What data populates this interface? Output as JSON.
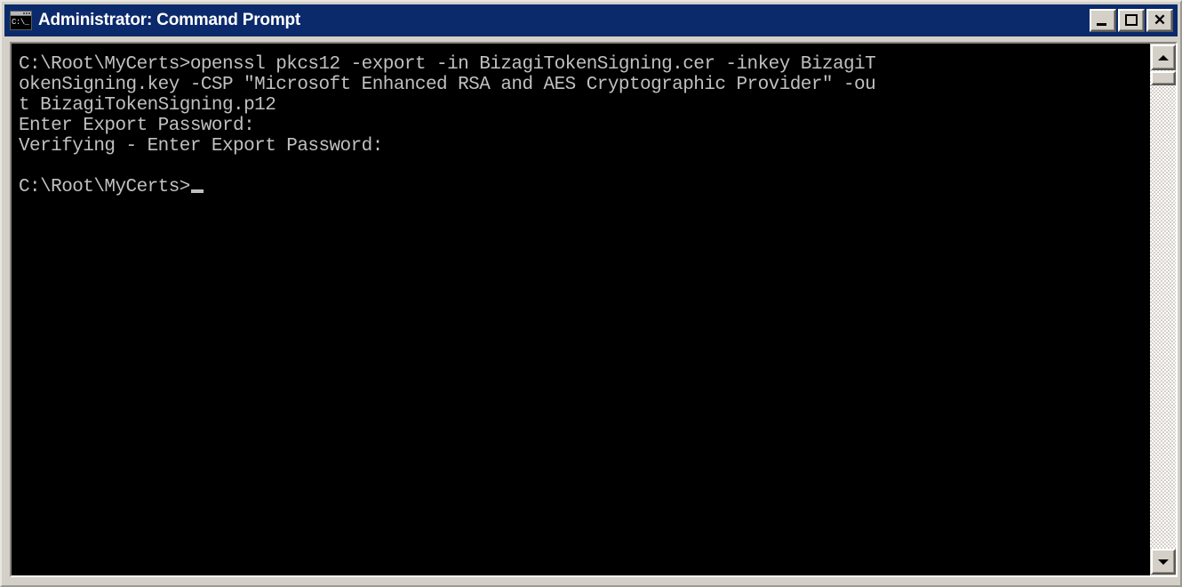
{
  "window": {
    "title": "Administrator: Command Prompt",
    "icon_name": "command-prompt-icon",
    "icon_glyph": "C:\\_",
    "colors": {
      "titlebar": "#0b2a6b",
      "titlebar_text": "#ffffff",
      "window_chrome": "#d4d0c8",
      "console_background": "#000000",
      "console_text": "#c0c0c0"
    },
    "controls": {
      "minimize_label": "_",
      "maximize_label": "□",
      "close_label": "×"
    }
  },
  "console": {
    "prompt_path": "C:\\Root\\MyCerts>",
    "columns": 80,
    "cursor": "block",
    "lines": [
      "C:\\Root\\MyCerts>openssl pkcs12 -export -in BizagiTokenSigning.cer -inkey BizagiT",
      "okenSigning.key -CSP \"Microsoft Enhanced RSA and AES Cryptographic Provider\" -ou",
      "t BizagiTokenSigning.p12",
      "Enter Export Password:",
      "Verifying - Enter Export Password:",
      "",
      "C:\\Root\\MyCerts>"
    ],
    "command": {
      "program": "openssl",
      "subcommand": "pkcs12",
      "flags": [
        "-export",
        "-in BizagiTokenSigning.cer",
        "-inkey BizagiTokenSigning.key",
        "-CSP \"Microsoft Enhanced RSA and AES Cryptographic Provider\"",
        "-out BizagiTokenSigning.p12"
      ]
    },
    "prompts": [
      "Enter Export Password:",
      "Verifying - Enter Export Password:"
    ]
  },
  "scrollbar": {
    "up_arrow": "▲",
    "down_arrow": "▼",
    "thumb_position": "top"
  }
}
